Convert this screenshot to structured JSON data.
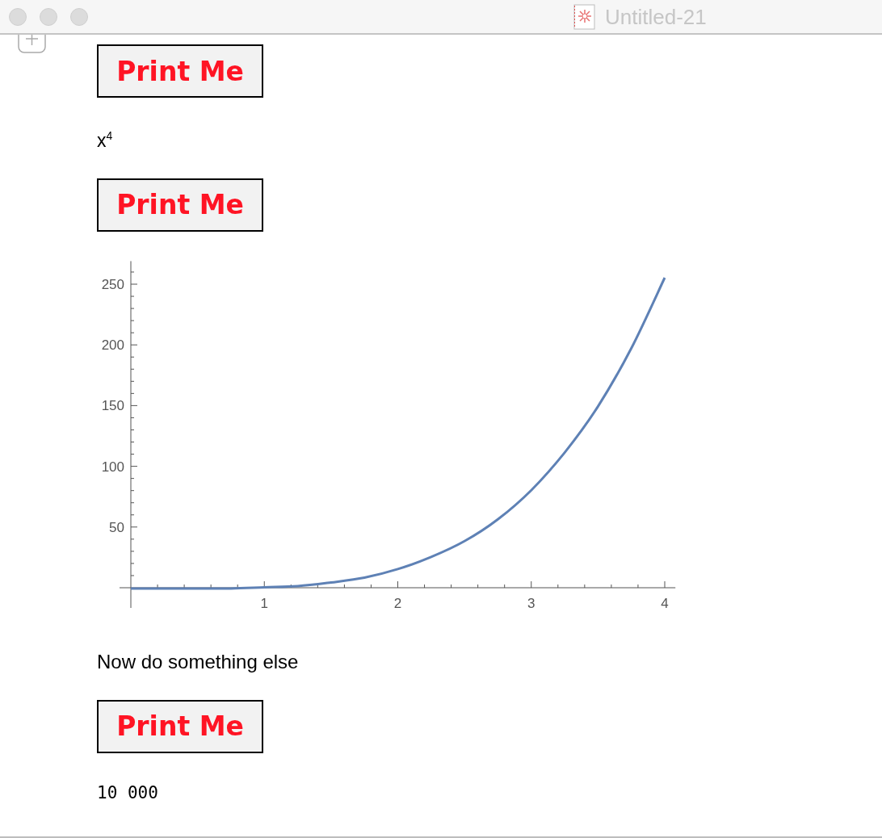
{
  "window": {
    "title": "Untitled-21"
  },
  "cells": [
    {
      "kind": "button",
      "label": "Print Me"
    },
    {
      "kind": "math",
      "text": "x$^{4}$"
    },
    {
      "kind": "button",
      "label": "Print Me"
    },
    {
      "kind": "plot",
      "chart_data": {
        "type": "line",
        "x": [
          0,
          0.25,
          0.5,
          0.75,
          1,
          1.25,
          1.5,
          1.75,
          2,
          2.25,
          2.5,
          2.75,
          3,
          3.25,
          3.5,
          3.75,
          4
        ],
        "series": [
          {
            "color": "#5e81b5",
            "values": [
              0,
              0,
              0,
              0,
              1,
              2,
              5,
              9,
              16,
              26,
              39,
              57,
              81,
              112,
              150,
              198,
              256
            ]
          }
        ],
        "xlim": [
          0,
          4.08
        ],
        "ylim": [
          0,
          269
        ],
        "xticks": [
          1,
          2,
          3,
          4
        ],
        "yticks": [
          50,
          100,
          150,
          200,
          250
        ]
      }
    },
    {
      "kind": "text",
      "text": "Now do something else"
    },
    {
      "kind": "button",
      "label": "Print Me"
    },
    {
      "kind": "output",
      "text": "10 000"
    }
  ]
}
